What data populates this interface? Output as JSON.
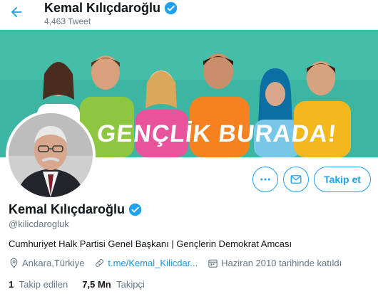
{
  "colors": {
    "accent": "#1da1f2",
    "link": "#1b95e0",
    "muted": "#657786",
    "text": "#0f1419",
    "banner_bg": "#3cb6a3"
  },
  "header": {
    "name": "Kemal Kılıçdaroğlu",
    "tweet_count": "4,463 Tweet"
  },
  "banner": {
    "text": "GENÇLİK BURADA!"
  },
  "actions": {
    "follow_label": "Takip et"
  },
  "profile": {
    "name": "Kemal Kılıçdaroğlu",
    "handle": "@kilicdarogluk",
    "bio": "Cumhuriyet Halk Partisi Genel Başkanı | Gençlerin Demokrat Amcası",
    "location": "Ankara,Türkiye",
    "link": "t.me/Kemal_Kilicdar...",
    "joined": "Haziran 2010 tarihinde katıldı"
  },
  "stats": {
    "following_count": "1",
    "following_label": "Takip edilen",
    "followers_count": "7,5 Mn",
    "followers_label": "Takipçi"
  }
}
